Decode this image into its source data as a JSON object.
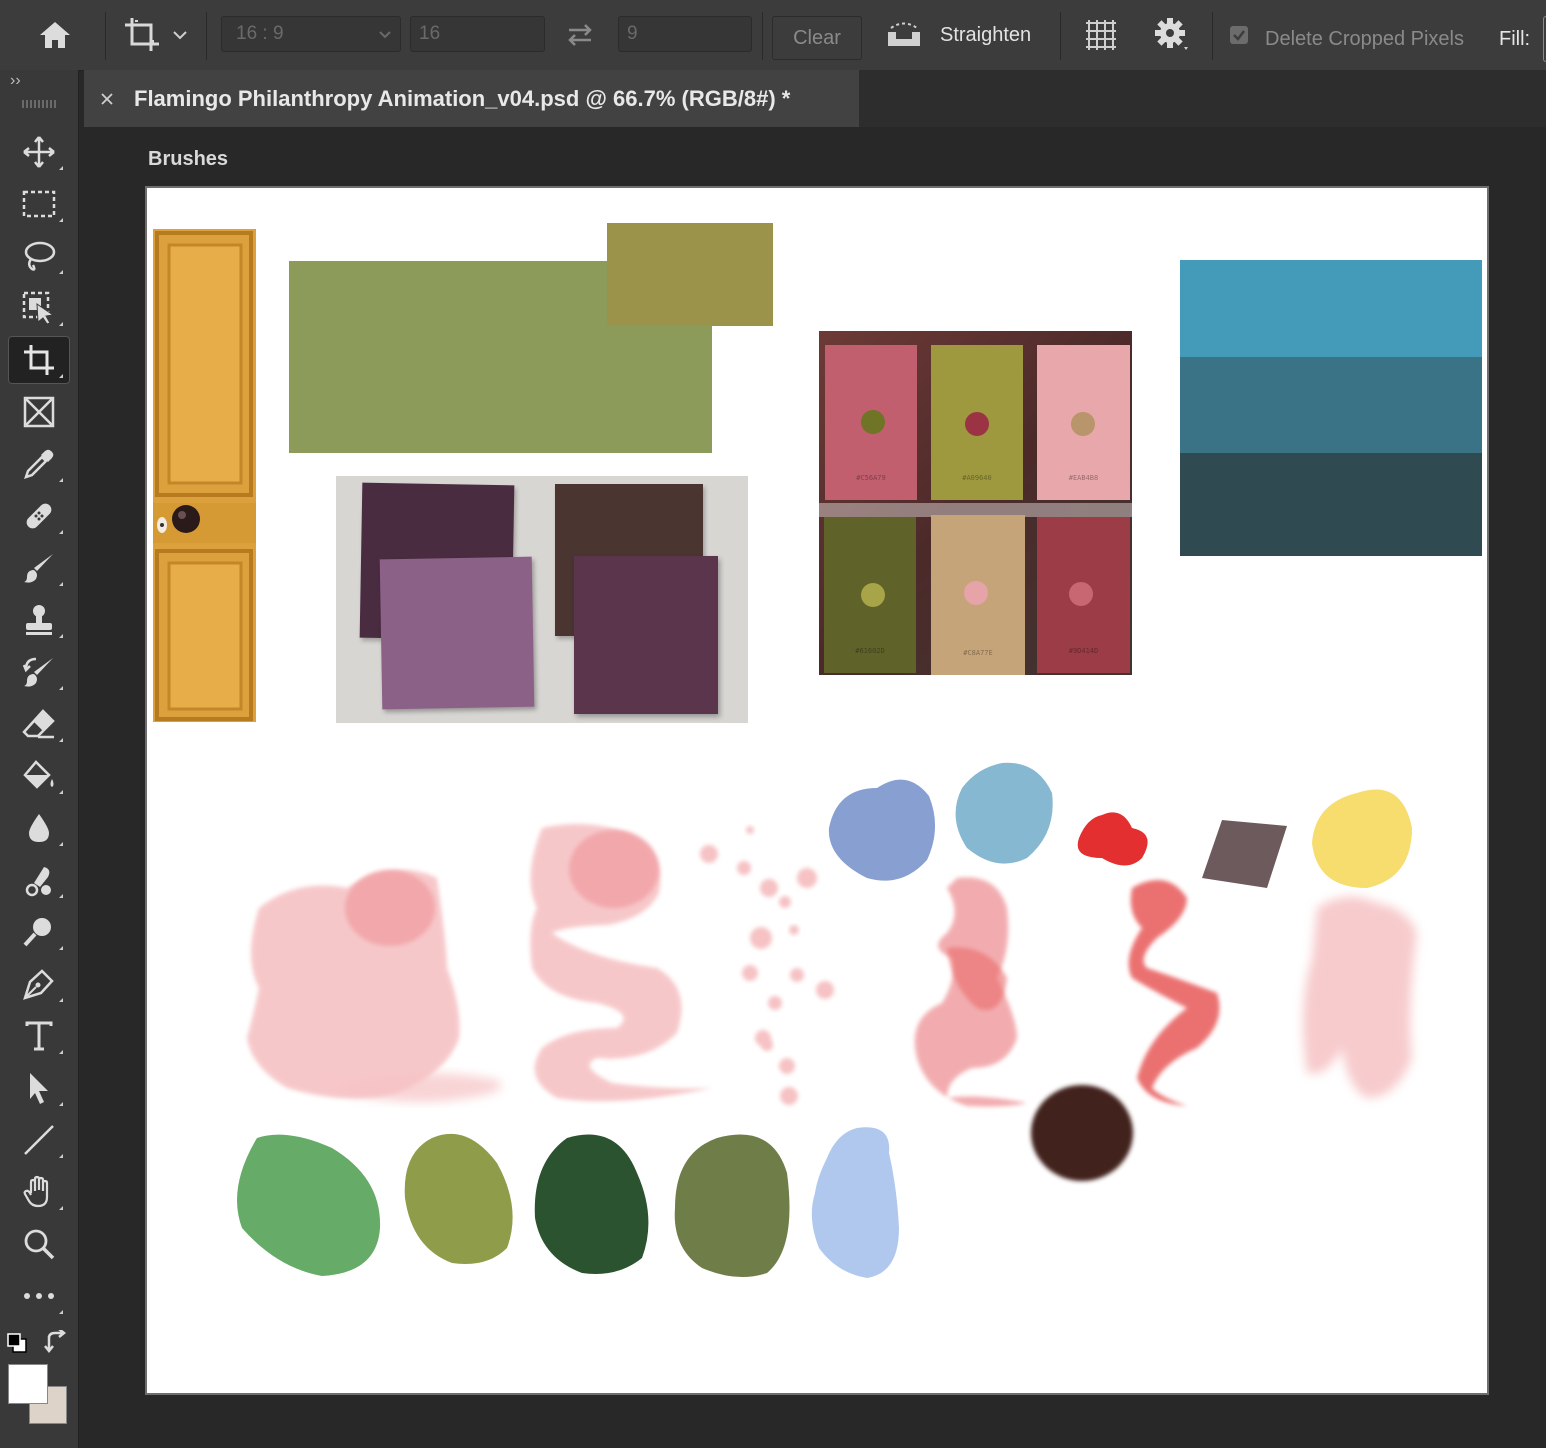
{
  "options_bar": {
    "ratio_label": "16 : 9",
    "width_value": "16",
    "height_value": "9",
    "clear_label": "Clear",
    "straighten_label": "Straighten",
    "delete_cropped_label": "Delete Cropped Pixels",
    "delete_cropped_checked": true,
    "fill_label": "Fill:"
  },
  "document": {
    "tab_title": "Flamingo Philanthropy Animation_v04.psd @ 66.7% (RGB/8#) *",
    "artboard_label": "Brushes"
  },
  "toolbar": {
    "tools": [
      "move-tool",
      "marquee-tool",
      "lasso-tool",
      "object-selection-tool",
      "crop-tool",
      "frame-tool",
      "eyedropper-tool",
      "healing-brush-tool",
      "brush-tool",
      "clone-stamp-tool",
      "history-brush-tool",
      "eraser-tool",
      "paint-bucket-tool",
      "blur-tool",
      "smudge-tool",
      "dodge-tool",
      "pen-tool",
      "type-tool",
      "path-selection-tool",
      "line-tool",
      "hand-tool",
      "zoom-tool",
      "more-tools"
    ],
    "active_tool": "crop-tool",
    "foreground_color": "#ffffff",
    "background_color": "#ddd3c9"
  },
  "palette_cards": [
    {
      "hex": "#C56A79",
      "card_color": "#c25f6f",
      "dot_color": "#6f7426"
    },
    {
      "hex": "#A09640",
      "card_color": "#9e993e",
      "dot_color": "#9b3344"
    },
    {
      "hex": "#EAB4B8",
      "card_color": "#e8a7ab",
      "dot_color": "#b8956a"
    },
    {
      "hex": "#61602D",
      "card_color": "#5f6229",
      "dot_color": "#a7a547"
    },
    {
      "hex": "#C8A77E",
      "card_color": "#c6a47a",
      "dot_color": "#e6a3a8"
    },
    {
      "hex": "#9D414D",
      "card_color": "#9c3c47",
      "dot_color": "#c86672"
    }
  ],
  "teal_stripes": [
    "#449ab9",
    "#3a7286",
    "#2f4a51"
  ],
  "swatches": {
    "door": "#dca03c",
    "sage": "#8c9a5a",
    "olive": "#9c934a",
    "fabric_background": "#d8d6d3",
    "fabric": [
      "#4a2c41",
      "#4b3531",
      "#8c6188",
      "#5b354c"
    ],
    "dabs": [
      "#879fd1",
      "#87b8d1",
      "#e32f2f",
      "#6d5a5d",
      "#f7dc6e",
      "#66ac68",
      "#8f9c4a",
      "#2c532f",
      "#6f7d49",
      "#b1c8ee",
      "#43201f"
    ],
    "pinks": [
      "#f6c2c4",
      "#f2a4a8",
      "#f1a4a7",
      "#ea6a6a"
    ]
  }
}
